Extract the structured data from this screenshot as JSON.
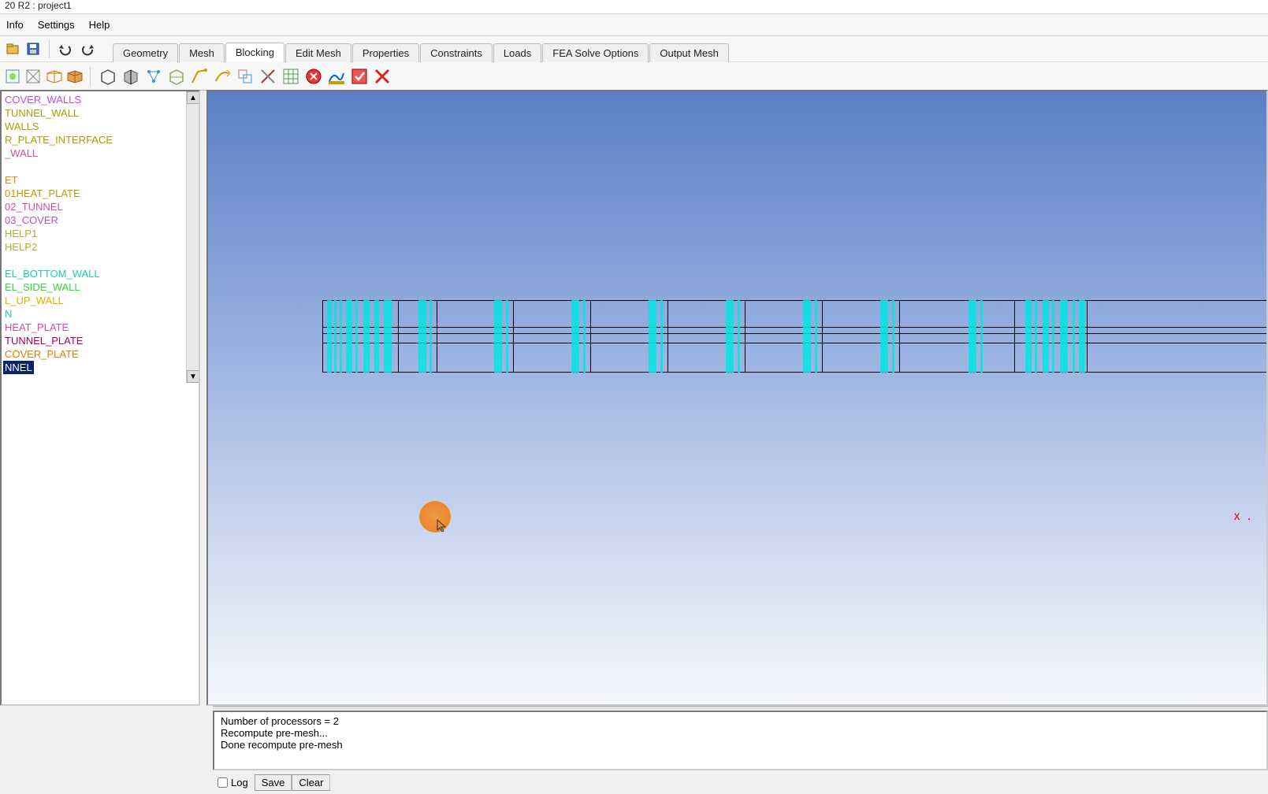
{
  "window": {
    "title": "20 R2 : project1"
  },
  "menu": {
    "items": [
      "Info",
      "Settings",
      "Help"
    ]
  },
  "tabs": {
    "items": [
      "Geometry",
      "Mesh",
      "Blocking",
      "Edit Mesh",
      "Properties",
      "Constraints",
      "Loads",
      "FEA Solve Options",
      "Output Mesh"
    ],
    "active_index": 2
  },
  "tree": {
    "items": [
      {
        "label": "COVER_WALLS",
        "color": "#b853d6"
      },
      {
        "label": "TUNNEL_WALL",
        "color": "#a8a000"
      },
      {
        "label": "WALLS",
        "color": "#a8a000"
      },
      {
        "label": "R_PLATE_INTERFACE",
        "color": "#a8a000"
      },
      {
        "label": "_WALL",
        "color": "#d64ea0"
      },
      {
        "label": "",
        "color": "#000"
      },
      {
        "label": "ET",
        "color": "#e68a00"
      },
      {
        "label": "01HEAT_PLATE",
        "color": "#c49a00"
      },
      {
        "label": "02_TUNNEL",
        "color": "#d64ea0"
      },
      {
        "label": "03_COVER",
        "color": "#b853d6"
      },
      {
        "label": "HELP1",
        "color": "#aab22c"
      },
      {
        "label": "HELP2",
        "color": "#aab22c"
      },
      {
        "label": "",
        "color": "#000"
      },
      {
        "label": "EL_BOTTOM_WALL",
        "color": "#1ecfa6"
      },
      {
        "label": "EL_SIDE_WALL",
        "color": "#37d637"
      },
      {
        "label": "L_UP_WALL",
        "color": "#e0b000"
      },
      {
        "label": "N",
        "color": "#1ecfa6"
      },
      {
        "label": "HEAT_PLATE",
        "color": "#d64ea0"
      },
      {
        "label": "TUNNEL_PLATE",
        "color": "#a80060"
      },
      {
        "label": "COVER_PLATE",
        "color": "#d68000"
      },
      {
        "label": "NNEL",
        "color": "#ffffff",
        "selected": true
      }
    ]
  },
  "viewport": {
    "axis_label": "X ."
  },
  "log": {
    "lines": [
      "Number of processors = 2",
      "Recompute pre-mesh...",
      "Done recompute pre-mesh"
    ],
    "checkbox": "Log",
    "save": "Save",
    "clear": "Clear"
  }
}
